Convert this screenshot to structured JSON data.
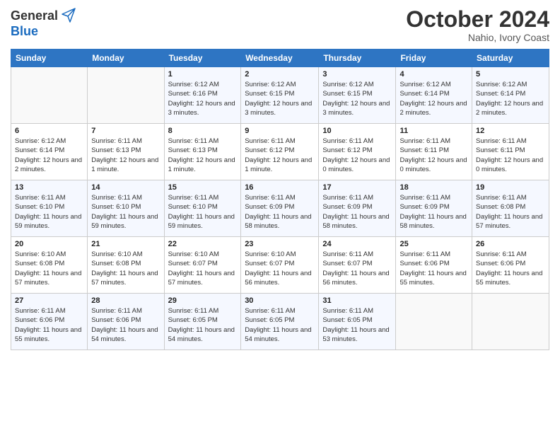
{
  "logo": {
    "general": "General",
    "blue": "Blue"
  },
  "title": "October 2024",
  "subtitle": "Nahio, Ivory Coast",
  "days_header": [
    "Sunday",
    "Monday",
    "Tuesday",
    "Wednesday",
    "Thursday",
    "Friday",
    "Saturday"
  ],
  "weeks": [
    [
      {
        "day": "",
        "info": ""
      },
      {
        "day": "",
        "info": ""
      },
      {
        "day": "1",
        "info": "Sunrise: 6:12 AM\nSunset: 6:16 PM\nDaylight: 12 hours and 3 minutes."
      },
      {
        "day": "2",
        "info": "Sunrise: 6:12 AM\nSunset: 6:15 PM\nDaylight: 12 hours and 3 minutes."
      },
      {
        "day": "3",
        "info": "Sunrise: 6:12 AM\nSunset: 6:15 PM\nDaylight: 12 hours and 3 minutes."
      },
      {
        "day": "4",
        "info": "Sunrise: 6:12 AM\nSunset: 6:14 PM\nDaylight: 12 hours and 2 minutes."
      },
      {
        "day": "5",
        "info": "Sunrise: 6:12 AM\nSunset: 6:14 PM\nDaylight: 12 hours and 2 minutes."
      }
    ],
    [
      {
        "day": "6",
        "info": "Sunrise: 6:12 AM\nSunset: 6:14 PM\nDaylight: 12 hours and 2 minutes."
      },
      {
        "day": "7",
        "info": "Sunrise: 6:11 AM\nSunset: 6:13 PM\nDaylight: 12 hours and 1 minute."
      },
      {
        "day": "8",
        "info": "Sunrise: 6:11 AM\nSunset: 6:13 PM\nDaylight: 12 hours and 1 minute."
      },
      {
        "day": "9",
        "info": "Sunrise: 6:11 AM\nSunset: 6:12 PM\nDaylight: 12 hours and 1 minute."
      },
      {
        "day": "10",
        "info": "Sunrise: 6:11 AM\nSunset: 6:12 PM\nDaylight: 12 hours and 0 minutes."
      },
      {
        "day": "11",
        "info": "Sunrise: 6:11 AM\nSunset: 6:11 PM\nDaylight: 12 hours and 0 minutes."
      },
      {
        "day": "12",
        "info": "Sunrise: 6:11 AM\nSunset: 6:11 PM\nDaylight: 12 hours and 0 minutes."
      }
    ],
    [
      {
        "day": "13",
        "info": "Sunrise: 6:11 AM\nSunset: 6:10 PM\nDaylight: 11 hours and 59 minutes."
      },
      {
        "day": "14",
        "info": "Sunrise: 6:11 AM\nSunset: 6:10 PM\nDaylight: 11 hours and 59 minutes."
      },
      {
        "day": "15",
        "info": "Sunrise: 6:11 AM\nSunset: 6:10 PM\nDaylight: 11 hours and 59 minutes."
      },
      {
        "day": "16",
        "info": "Sunrise: 6:11 AM\nSunset: 6:09 PM\nDaylight: 11 hours and 58 minutes."
      },
      {
        "day": "17",
        "info": "Sunrise: 6:11 AM\nSunset: 6:09 PM\nDaylight: 11 hours and 58 minutes."
      },
      {
        "day": "18",
        "info": "Sunrise: 6:11 AM\nSunset: 6:09 PM\nDaylight: 11 hours and 58 minutes."
      },
      {
        "day": "19",
        "info": "Sunrise: 6:11 AM\nSunset: 6:08 PM\nDaylight: 11 hours and 57 minutes."
      }
    ],
    [
      {
        "day": "20",
        "info": "Sunrise: 6:10 AM\nSunset: 6:08 PM\nDaylight: 11 hours and 57 minutes."
      },
      {
        "day": "21",
        "info": "Sunrise: 6:10 AM\nSunset: 6:08 PM\nDaylight: 11 hours and 57 minutes."
      },
      {
        "day": "22",
        "info": "Sunrise: 6:10 AM\nSunset: 6:07 PM\nDaylight: 11 hours and 57 minutes."
      },
      {
        "day": "23",
        "info": "Sunrise: 6:10 AM\nSunset: 6:07 PM\nDaylight: 11 hours and 56 minutes."
      },
      {
        "day": "24",
        "info": "Sunrise: 6:11 AM\nSunset: 6:07 PM\nDaylight: 11 hours and 56 minutes."
      },
      {
        "day": "25",
        "info": "Sunrise: 6:11 AM\nSunset: 6:06 PM\nDaylight: 11 hours and 55 minutes."
      },
      {
        "day": "26",
        "info": "Sunrise: 6:11 AM\nSunset: 6:06 PM\nDaylight: 11 hours and 55 minutes."
      }
    ],
    [
      {
        "day": "27",
        "info": "Sunrise: 6:11 AM\nSunset: 6:06 PM\nDaylight: 11 hours and 55 minutes."
      },
      {
        "day": "28",
        "info": "Sunrise: 6:11 AM\nSunset: 6:06 PM\nDaylight: 11 hours and 54 minutes."
      },
      {
        "day": "29",
        "info": "Sunrise: 6:11 AM\nSunset: 6:05 PM\nDaylight: 11 hours and 54 minutes."
      },
      {
        "day": "30",
        "info": "Sunrise: 6:11 AM\nSunset: 6:05 PM\nDaylight: 11 hours and 54 minutes."
      },
      {
        "day": "31",
        "info": "Sunrise: 6:11 AM\nSunset: 6:05 PM\nDaylight: 11 hours and 53 minutes."
      },
      {
        "day": "",
        "info": ""
      },
      {
        "day": "",
        "info": ""
      }
    ]
  ]
}
